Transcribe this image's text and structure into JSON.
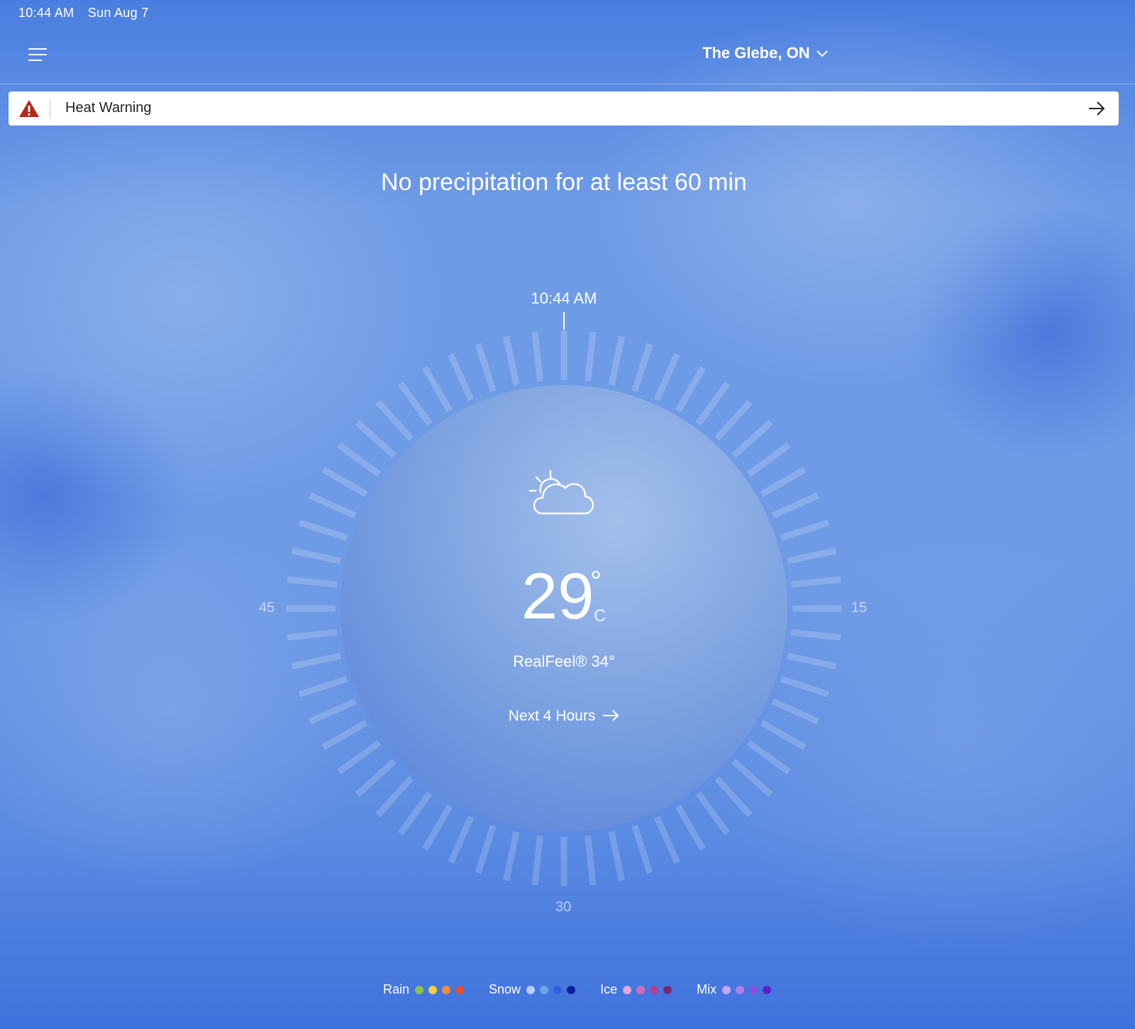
{
  "status_bar": {
    "time": "10:44 AM",
    "date": "Sun Aug 7"
  },
  "header": {
    "location": "The Glebe, ON"
  },
  "alert": {
    "label": "Heat Warning"
  },
  "minutecast": {
    "headline": "No precipitation for at least 60 min",
    "current_time": "10:44 AM",
    "minute_labels": {
      "right": "15",
      "bottom": "30",
      "left": "45"
    }
  },
  "current": {
    "icon": "partly-sunny-cloud-icon",
    "temperature": "29",
    "degree_symbol": "°",
    "unit": "C",
    "realfeel": "RealFeel® 34°",
    "next_hours_label": "Next 4 Hours"
  },
  "legend": [
    {
      "label": "Rain",
      "colors": [
        "#8bc34a",
        "#f4d03f",
        "#f08a3c",
        "#e2502d"
      ]
    },
    {
      "label": "Snow",
      "colors": [
        "#b9cdf5",
        "#6fa3ec",
        "#2f5ee6",
        "#0b1f9c"
      ]
    },
    {
      "label": "Ice",
      "colors": [
        "#e6a6d8",
        "#d46bb8",
        "#b13e95",
        "#7a2b6e"
      ]
    },
    {
      "label": "Mix",
      "colors": [
        "#c6a6f0",
        "#b07de8",
        "#8a4fe0",
        "#5e1fc8"
      ]
    }
  ],
  "colors": {
    "background": "#3c6fdc",
    "alert_icon": "#b22a1c"
  }
}
